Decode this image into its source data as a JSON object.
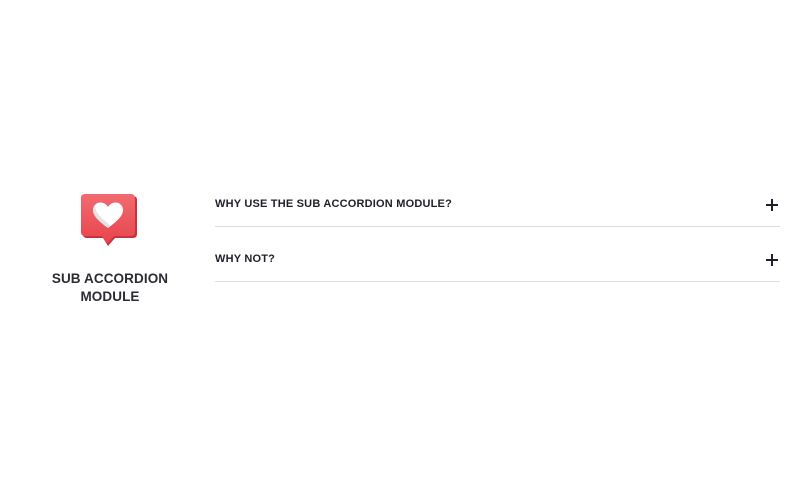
{
  "module": {
    "icon": "heart-speech-bubble-icon",
    "title_line1": "SUB ACCORDION",
    "title_line2": "MODULE"
  },
  "accordion": {
    "items": [
      {
        "label": "WHY USE THE SUB ACCORDION MODULE?",
        "icon": "plus-icon",
        "expanded": false
      },
      {
        "label": "WHY NOT?",
        "icon": "plus-icon",
        "expanded": false
      }
    ]
  },
  "colors": {
    "icon_red": "#f0545c",
    "icon_dark_red": "#c9323d",
    "text": "#1f1f2a",
    "divider": "#dcdcdc"
  }
}
